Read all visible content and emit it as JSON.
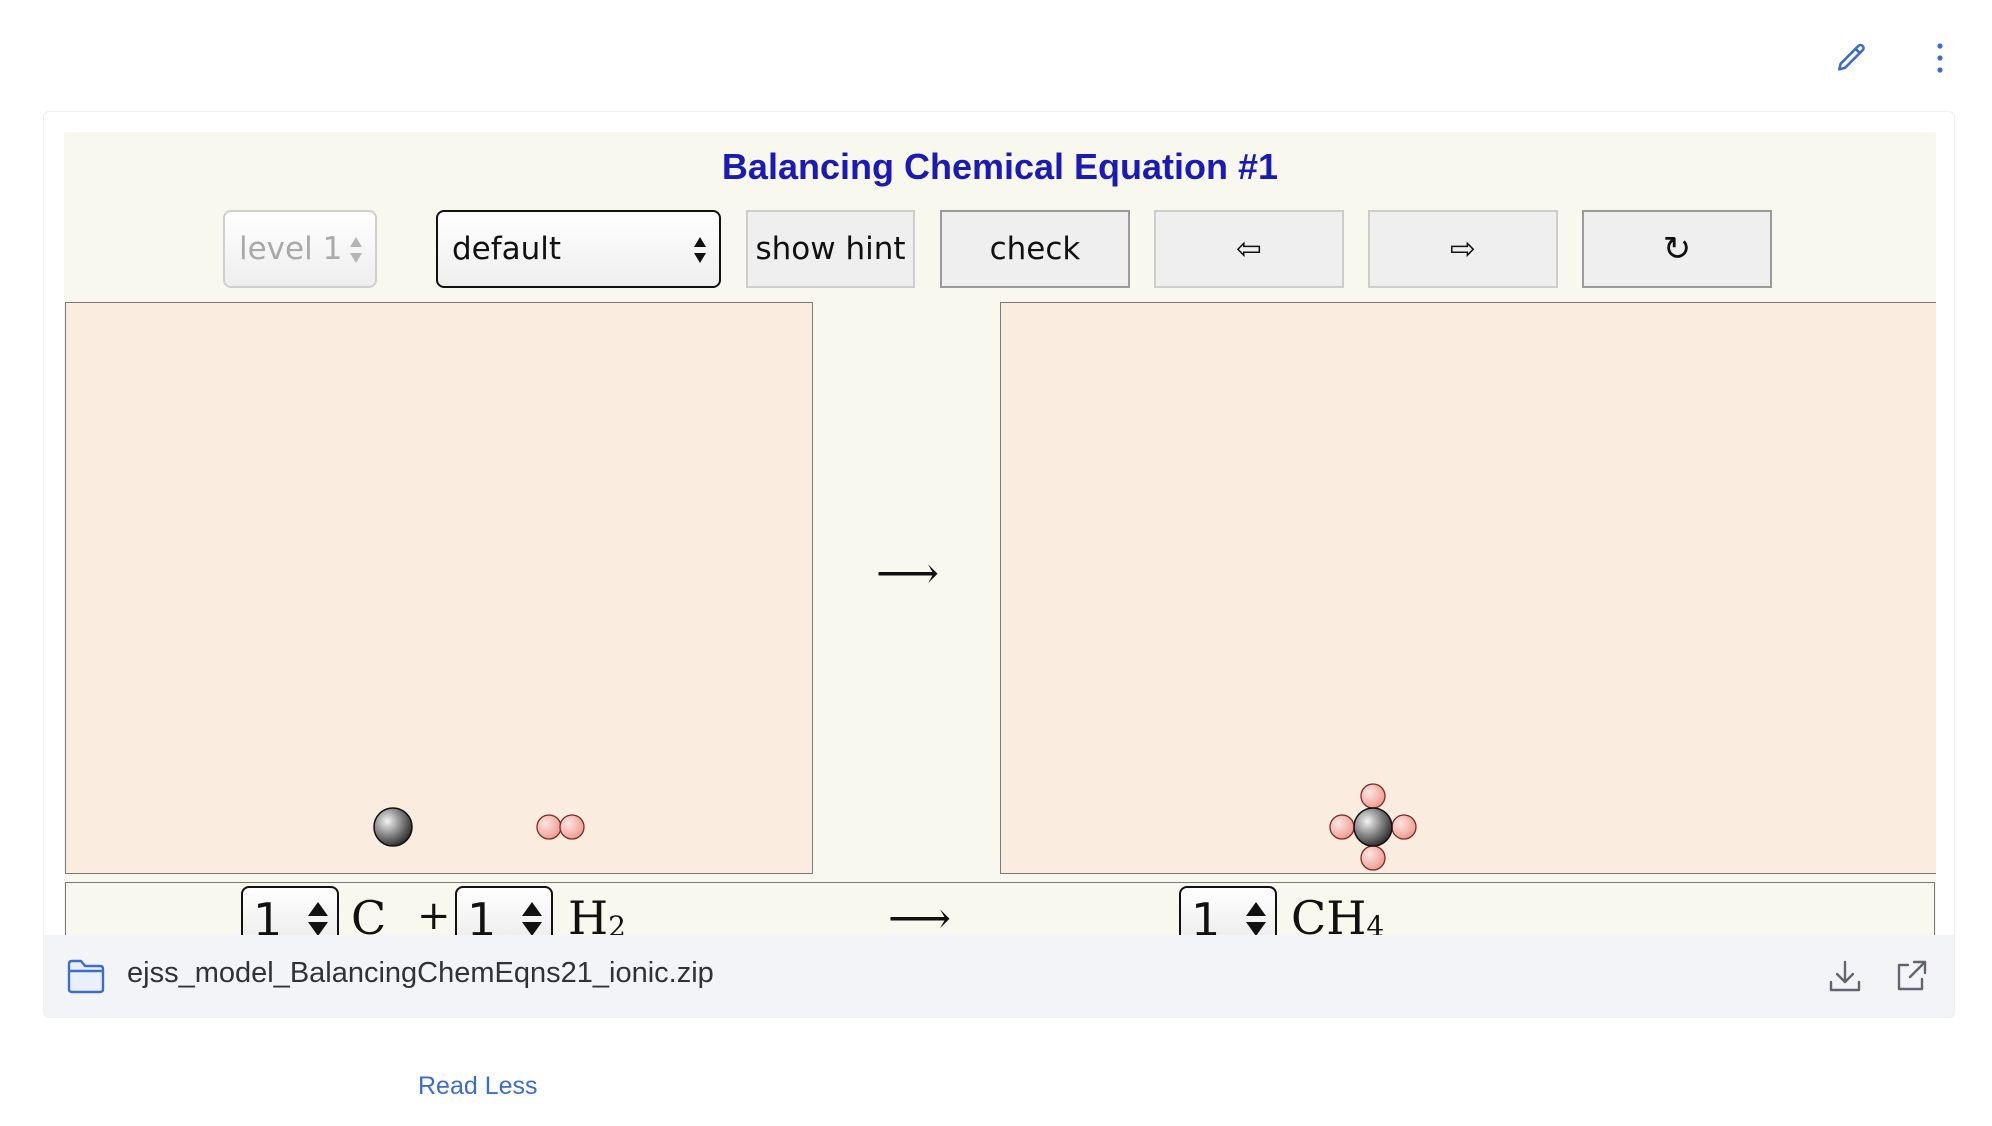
{
  "toolbar": {
    "edit_icon": "pencil-icon",
    "more_icon": "more-vertical-icon"
  },
  "sim": {
    "title": "Balancing Chemical Equation #1",
    "level_select": {
      "value": "level 1",
      "disabled": true
    },
    "mode_select": {
      "value": "default"
    },
    "buttons": {
      "hint": "show hint",
      "check": "check",
      "back": "⇦",
      "forward": "⇨",
      "reset": "↻"
    },
    "reaction_arrow": "⟶",
    "reactants": [
      {
        "coefficient": "1",
        "formula": "C"
      },
      {
        "coefficient": "1",
        "formula_base": "H",
        "formula_sub": "2"
      }
    ],
    "plus": "+",
    "products": [
      {
        "coefficient": "1",
        "formula_base": "CH",
        "formula_sub": "4"
      }
    ],
    "colors": {
      "title": "#1a1ab6",
      "panel": "#faede0",
      "background": "#f9f8ef",
      "carbon": "#7f7f7f",
      "hydrogen": "#f2aba3"
    }
  },
  "file": {
    "name": "ejss_model_BalancingChemEqns21_ionic.zip",
    "folder_icon": "folder-icon",
    "download_icon": "download-icon",
    "open_icon": "external-link-icon"
  },
  "footer": {
    "read_less": "Read Less"
  }
}
